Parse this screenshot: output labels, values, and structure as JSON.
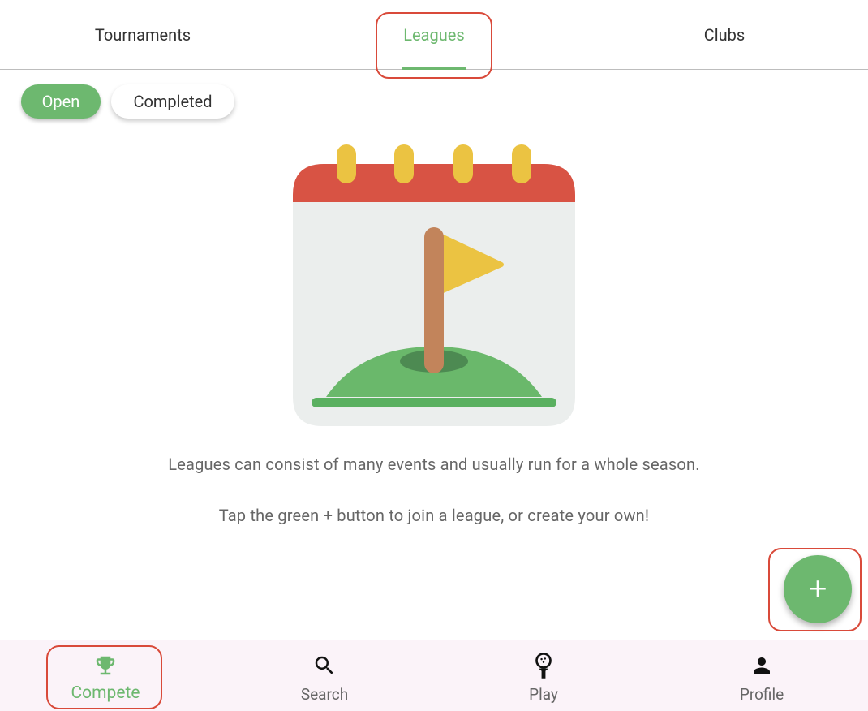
{
  "tabs": [
    {
      "label": "Tournaments",
      "selected": false
    },
    {
      "label": "Leagues",
      "selected": true
    },
    {
      "label": "Clubs",
      "selected": false
    }
  ],
  "filters": {
    "open_label": "Open",
    "completed_label": "Completed",
    "selected": "Open"
  },
  "illustration": {
    "icon": "calendar-with-golf-flag-icon"
  },
  "empty_state": {
    "line1": "Leagues can consist of many events and usually run for a whole season.",
    "line2": "Tap the green + button to join a league, or create your own!"
  },
  "fab": {
    "label": "+",
    "icon": "plus-icon"
  },
  "bottom_nav": [
    {
      "label": "Compete",
      "icon": "trophy-icon",
      "selected": true
    },
    {
      "label": "Search",
      "icon": "search-icon",
      "selected": false
    },
    {
      "label": "Play",
      "icon": "golf-ball-tee-icon",
      "selected": false
    },
    {
      "label": "Profile",
      "icon": "person-icon",
      "selected": false
    }
  ],
  "colors": {
    "accent": "#6db86f",
    "annotation": "#d94a3a",
    "nav_background": "#fbf3f9"
  }
}
